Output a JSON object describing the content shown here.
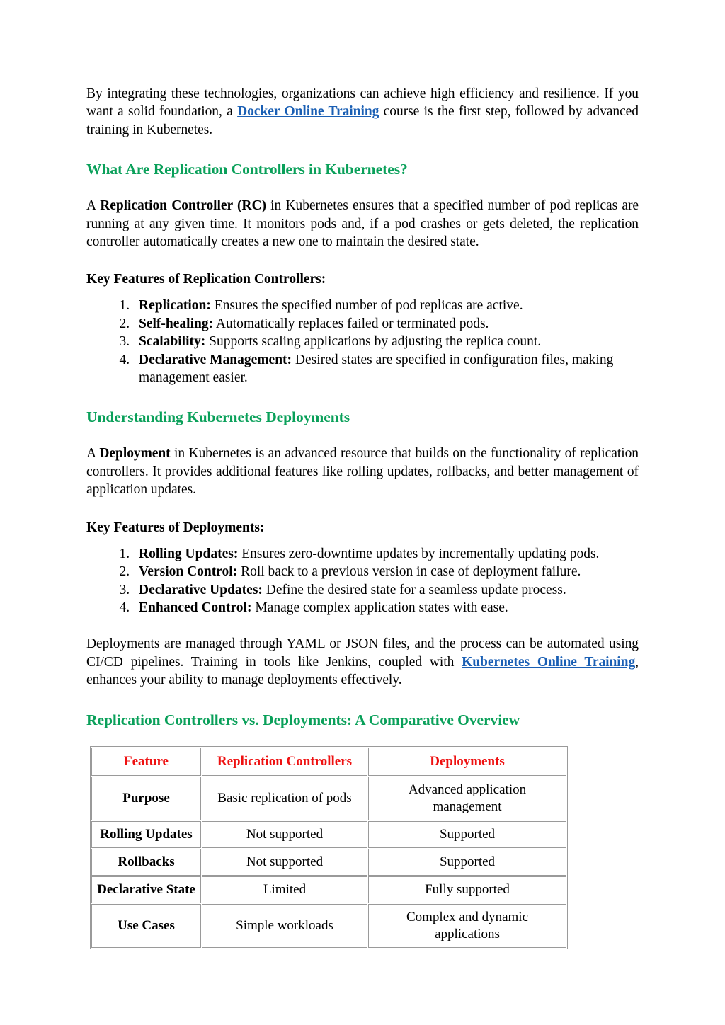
{
  "intro": {
    "before_link": "By integrating these technologies, organizations can achieve high efficiency and resilience. If you want a solid foundation, a ",
    "link_text": "Docker Online Training",
    "after_link": " course is the first step, followed by advanced training in Kubernetes."
  },
  "section_rc": {
    "heading": "What Are Replication Controllers in Kubernetes?",
    "paragraph_lead": "A ",
    "paragraph_bold": "Replication Controller (RC)",
    "paragraph_rest": " in Kubernetes ensures that a specified number of pod replicas are running at any given time. It monitors pods and, if a pod crashes or gets deleted, the replication controller automatically creates a new one to maintain the desired state.",
    "list_heading": "Key Features of Replication Controllers:",
    "items": [
      {
        "term": "Replication:",
        "text": " Ensures the specified number of pod replicas are active."
      },
      {
        "term": "Self-healing:",
        "text": " Automatically replaces failed or terminated pods."
      },
      {
        "term": "Scalability:",
        "text": " Supports scaling applications by adjusting the replica count."
      },
      {
        "term": "Declarative Management:",
        "text": " Desired states are specified in configuration files, making management easier."
      }
    ]
  },
  "section_deploy": {
    "heading": "Understanding Kubernetes Deployments",
    "paragraph_lead": "A ",
    "paragraph_bold": "Deployment",
    "paragraph_rest": " in Kubernetes is an advanced resource that builds on the functionality of replication controllers. It provides additional features like rolling updates, rollbacks, and better management of application updates.",
    "list_heading": "Key Features of Deployments:",
    "items": [
      {
        "term": "Rolling Updates:",
        "text": " Ensures zero-downtime updates by incrementally updating pods."
      },
      {
        "term": "Version Control:",
        "text": " Roll back to a previous version in case of deployment failure."
      },
      {
        "term": "Declarative Updates:",
        "text": " Define the desired state for a seamless update process."
      },
      {
        "term": "Enhanced Control:",
        "text": " Manage complex application states with ease."
      }
    ],
    "closing_before_link": "Deployments are managed through YAML or JSON files, and the process can be automated using CI/CD pipelines. Training in tools like Jenkins, coupled with ",
    "closing_link_text": "Kubernetes Online Training",
    "closing_after_link": ", enhances your ability to manage deployments effectively."
  },
  "section_compare": {
    "heading": "Replication Controllers vs. Deployments: A Comparative Overview",
    "table": {
      "headers": [
        "Feature",
        "Replication Controllers",
        "Deployments"
      ],
      "rows": [
        {
          "feature": "Purpose",
          "rc": "Basic replication of pods",
          "dep": "Advanced application management"
        },
        {
          "feature": "Rolling Updates",
          "rc": "Not supported",
          "dep": "Supported"
        },
        {
          "feature": "Rollbacks",
          "rc": "Not supported",
          "dep": "Supported"
        },
        {
          "feature": "Declarative State",
          "rc": "Limited",
          "dep": "Fully supported"
        },
        {
          "feature": "Use Cases",
          "rc": "Simple workloads",
          "dep": "Complex and dynamic applications"
        }
      ]
    }
  },
  "colors": {
    "heading_green": "#0aa05a",
    "link_blue": "#1a5fb4",
    "table_header_red": "#ee1111",
    "body_black": "#000000"
  }
}
